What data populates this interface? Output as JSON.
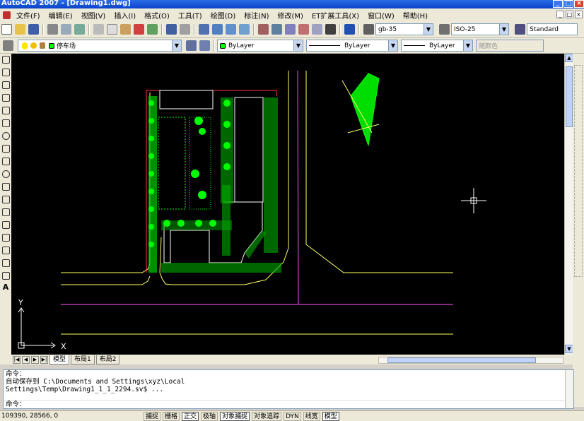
{
  "window": {
    "title": "AutoCAD 2007 - [Drawing1.dwg]",
    "controls": [
      "_",
      "□",
      "×"
    ]
  },
  "menu": {
    "items": [
      "文件(F)",
      "编辑(E)",
      "视图(V)",
      "插入(I)",
      "格式(O)",
      "工具(T)",
      "绘图(D)",
      "标注(N)",
      "修改(M)",
      "ET扩展工具(X)",
      "窗口(W)",
      "帮助(H)"
    ],
    "doc_controls": [
      "_",
      "□",
      "×"
    ]
  },
  "toolbar": {
    "text_style": "gb-35",
    "dim_style": "ISO-25",
    "table_style": "Standard"
  },
  "layers": {
    "current_layer": "停车场",
    "color": "ByLayer",
    "linetype": "ByLayer",
    "lineweight": "ByLayer",
    "plot_style": "随颜色"
  },
  "colors": {
    "canvas_bg": "#000000",
    "green": "#00ff00",
    "yellow": "#ffff66",
    "magenta": "#cc44cc",
    "red": "#ff3333",
    "white": "#ffffff"
  },
  "canvas": {
    "ucs_x": "X",
    "ucs_y": "Y"
  },
  "tabs": [
    "模型",
    "布局1",
    "布局2"
  ],
  "command": {
    "lines": [
      "命令：",
      "自动保存到 C:\\Documents and Settings\\xyz\\Local",
      "Settings\\Temp\\Drawing1_1_1_2294.sv$ ..."
    ],
    "prompt": "命令："
  },
  "status": {
    "coords": "109390, 28566, 0",
    "buttons": [
      {
        "label": "捕捉",
        "on": false
      },
      {
        "label": "栅格",
        "on": false
      },
      {
        "label": "正交",
        "on": true
      },
      {
        "label": "极轴",
        "on": false
      },
      {
        "label": "对象捕捉",
        "on": true
      },
      {
        "label": "对象追踪",
        "on": false
      },
      {
        "label": "DYN",
        "on": false
      },
      {
        "label": "线宽",
        "on": false
      },
      {
        "label": "模型",
        "on": true
      }
    ]
  }
}
